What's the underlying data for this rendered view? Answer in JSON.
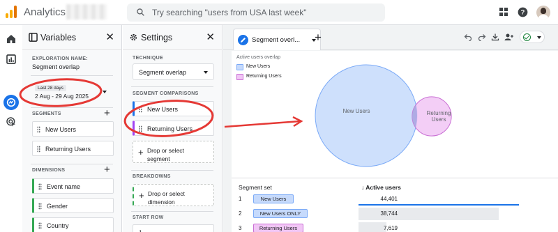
{
  "app": {
    "title": "Analytics",
    "search_placeholder": "Try searching \"users from USA last week\""
  },
  "variables_panel": {
    "title": "Variables",
    "exploration_name_label": "EXPLORATION NAME:",
    "exploration_name": "Segment overlap",
    "date_range_label": "Last 28 days",
    "date_range": "2 Aug - 29 Aug 2025",
    "segments_label": "SEGMENTS",
    "segments": [
      "New Users",
      "Returning Users"
    ],
    "dimensions_label": "DIMENSIONS",
    "dimensions": [
      "Event name",
      "Gender",
      "Country"
    ]
  },
  "settings_panel": {
    "title": "Settings",
    "technique_label": "TECHNIQUE",
    "technique": "Segment overlap",
    "segment_comparisons_label": "SEGMENT COMPARISONS",
    "segment_comparisons": [
      "New Users",
      "Returning Users"
    ],
    "drop_segment": "Drop or select segment",
    "breakdowns_label": "BREAKDOWNS",
    "drop_dimension": "Drop or select dimension",
    "start_row_label": "START ROW",
    "start_row": "1"
  },
  "main": {
    "tab_label": "Segment overl...",
    "chart_title": "Active users overlap",
    "colors": {
      "new_users_fill": "#c6dafc",
      "new_users_stroke": "#7baaf7",
      "returning_users_fill": "#f1c6f5",
      "returning_users_stroke": "#c96fd4",
      "annotation": "#e53935"
    },
    "table": {
      "col_segment": "Segment set",
      "col_metric": "↓ Active users",
      "rows": [
        {
          "num": "1",
          "segment": "New Users",
          "value": "44,401",
          "fraction": 1.0
        },
        {
          "num": "2",
          "segment": "New Users ONLY",
          "value": "38,744",
          "fraction": 0.873
        },
        {
          "num": "3",
          "segment": "Returning Users",
          "value": "7,619",
          "fraction": 0.172
        }
      ]
    }
  },
  "chart_data": {
    "type": "venn",
    "title": "Active users overlap",
    "sets": [
      {
        "name": "New Users",
        "value": 44401
      },
      {
        "name": "Returning Users",
        "value": 7619
      }
    ],
    "intersections": [
      {
        "sets": [
          "New Users"
        ],
        "label": "New Users ONLY",
        "value": 38744
      }
    ]
  }
}
